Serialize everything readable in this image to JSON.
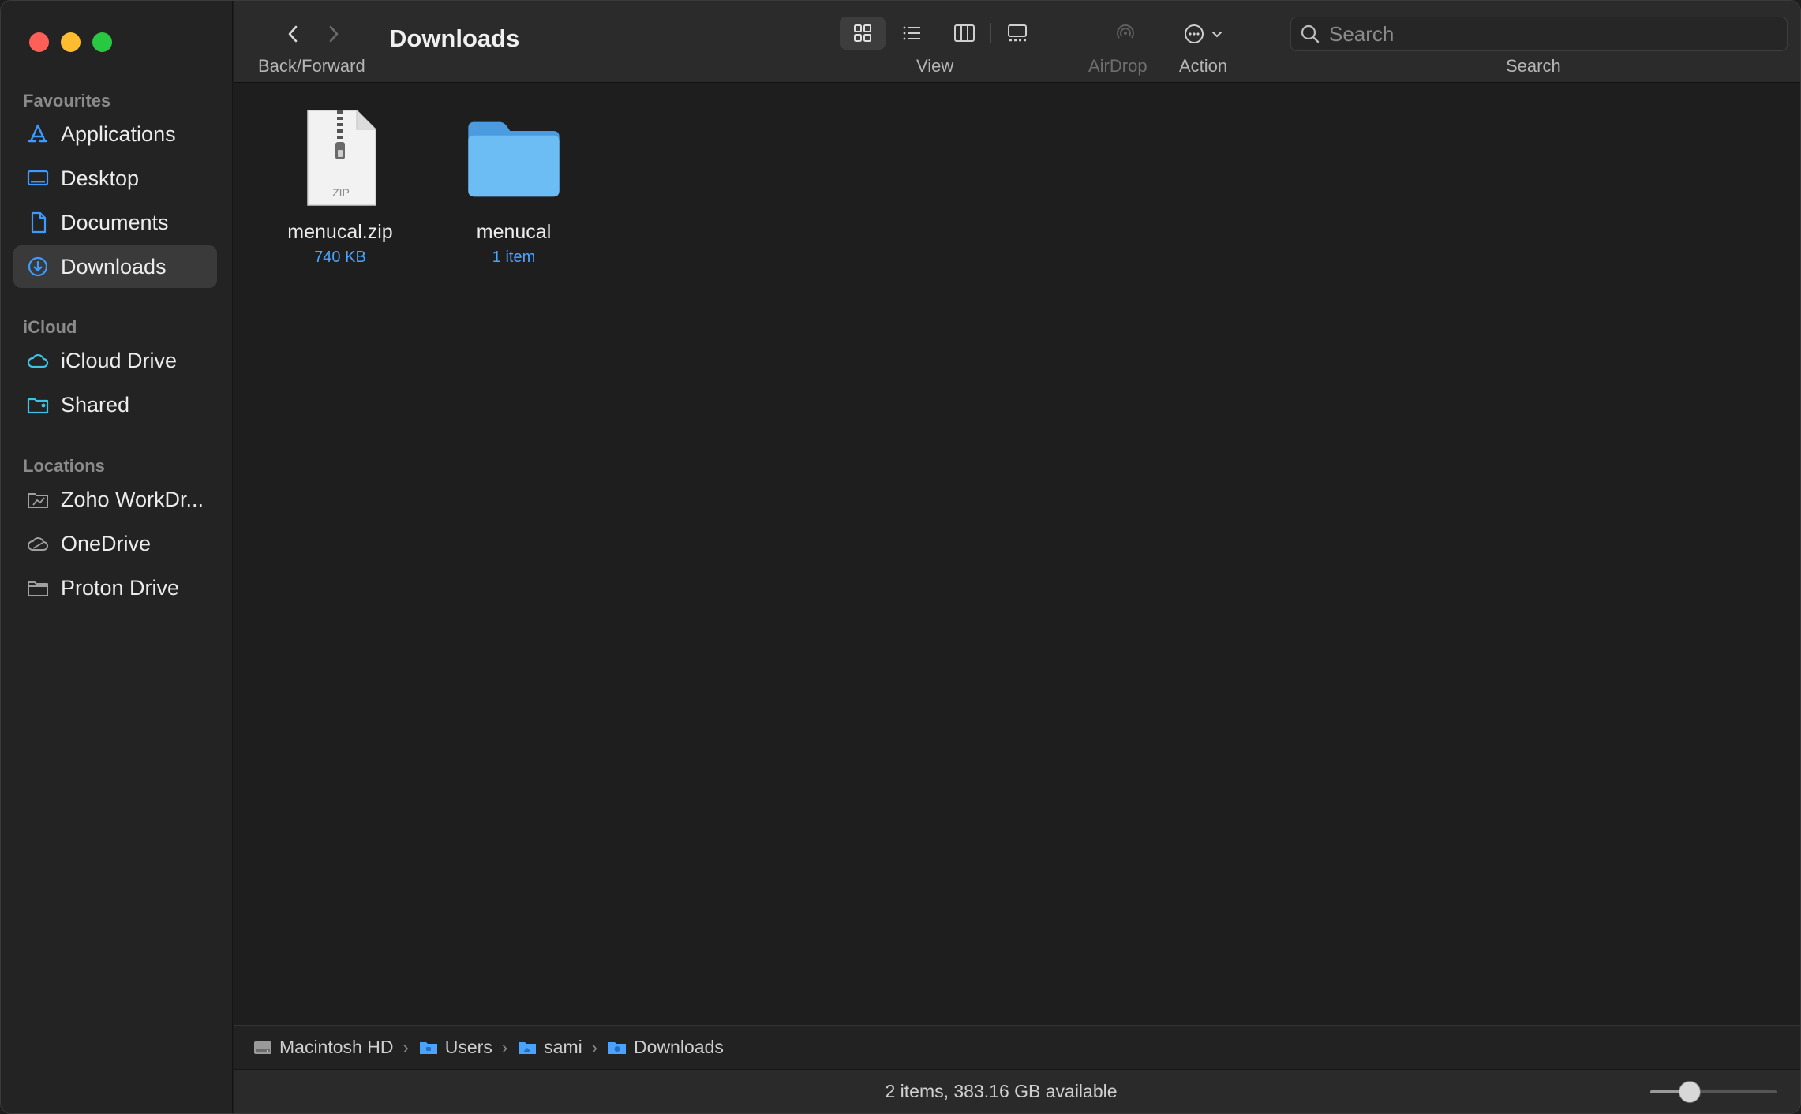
{
  "window": {
    "title": "Downloads"
  },
  "sidebar": {
    "sections": [
      {
        "title": "Favourites",
        "items": [
          {
            "label": "Applications",
            "icon": "applications-icon"
          },
          {
            "label": "Desktop",
            "icon": "desktop-icon"
          },
          {
            "label": "Documents",
            "icon": "document-icon"
          },
          {
            "label": "Downloads",
            "icon": "download-icon",
            "active": true
          }
        ]
      },
      {
        "title": "iCloud",
        "items": [
          {
            "label": "iCloud Drive",
            "icon": "cloud-icon"
          },
          {
            "label": "Shared",
            "icon": "shared-folder-icon"
          }
        ]
      },
      {
        "title": "Locations",
        "items": [
          {
            "label": "Zoho WorkDr...",
            "icon": "drive-folder-icon"
          },
          {
            "label": "OneDrive",
            "icon": "cloud-icon"
          },
          {
            "label": "Proton Drive",
            "icon": "folder-icon"
          }
        ]
      }
    ]
  },
  "toolbar": {
    "nav_caption": "Back/Forward",
    "view_caption": "View",
    "airdrop_caption": "AirDrop",
    "action_caption": "Action",
    "search_caption": "Search",
    "search_placeholder": "Search"
  },
  "files": [
    {
      "name": "menucal.zip",
      "meta": "740 KB",
      "kind": "zip",
      "badge": "ZIP"
    },
    {
      "name": "menucal",
      "meta": "1 item",
      "kind": "folder"
    }
  ],
  "path": [
    {
      "label": "Macintosh HD",
      "icon": "hard-drive-icon"
    },
    {
      "label": "Users",
      "icon": "folder-icon"
    },
    {
      "label": "sami",
      "icon": "home-folder-icon"
    },
    {
      "label": "Downloads",
      "icon": "downloads-folder-icon"
    }
  ],
  "status": {
    "text": "2 items, 383.16 GB available",
    "icon_size_fraction": 0.27
  },
  "colors": {
    "accent": "#4aa3ff",
    "folder": "#5bb0f0"
  }
}
